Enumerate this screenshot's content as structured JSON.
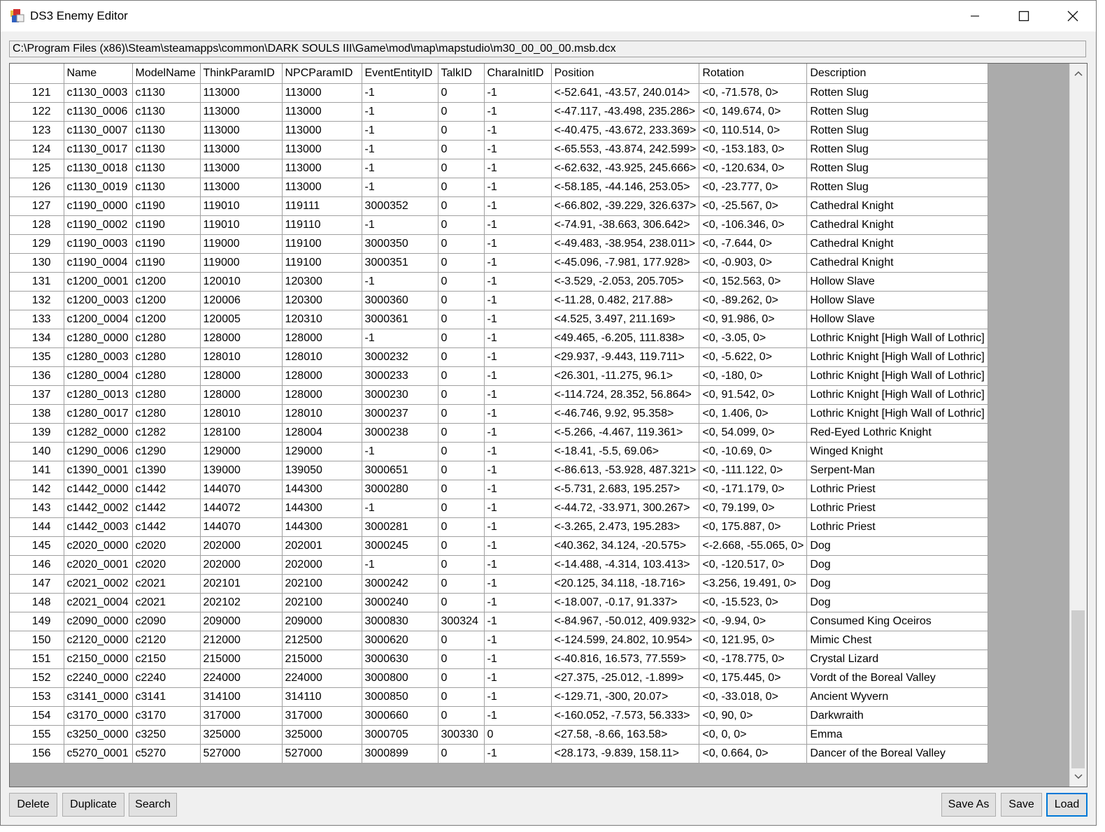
{
  "window": {
    "title": "DS3 Enemy Editor",
    "minimize_icon": "minimize-icon",
    "maximize_icon": "maximize-icon",
    "close_icon": "close-icon"
  },
  "path": "C:\\Program Files (x86)\\Steam\\steamapps\\common\\DARK SOULS III\\Game\\mod\\map\\mapstudio\\m30_00_00_00.msb.dcx",
  "grid": {
    "columns": [
      "Name",
      "ModelName",
      "ThinkParamID",
      "NPCParamID",
      "EventEntityID",
      "TalkID",
      "CharaInitID",
      "Position",
      "Rotation",
      "Description"
    ],
    "rows": [
      [
        "121",
        "c1130_0003",
        "c1130",
        "113000",
        "113000",
        "-1",
        "0",
        "-1",
        "<-52.641, -43.57, 240.014>",
        "<0, -71.578, 0>",
        "Rotten Slug"
      ],
      [
        "122",
        "c1130_0006",
        "c1130",
        "113000",
        "113000",
        "-1",
        "0",
        "-1",
        "<-47.117, -43.498, 235.286>",
        "<0, 149.674, 0>",
        "Rotten Slug"
      ],
      [
        "123",
        "c1130_0007",
        "c1130",
        "113000",
        "113000",
        "-1",
        "0",
        "-1",
        "<-40.475, -43.672, 233.369>",
        "<0, 110.514, 0>",
        "Rotten Slug"
      ],
      [
        "124",
        "c1130_0017",
        "c1130",
        "113000",
        "113000",
        "-1",
        "0",
        "-1",
        "<-65.553, -43.874, 242.599>",
        "<0, -153.183, 0>",
        "Rotten Slug"
      ],
      [
        "125",
        "c1130_0018",
        "c1130",
        "113000",
        "113000",
        "-1",
        "0",
        "-1",
        "<-62.632, -43.925, 245.666>",
        "<0, -120.634, 0>",
        "Rotten Slug"
      ],
      [
        "126",
        "c1130_0019",
        "c1130",
        "113000",
        "113000",
        "-1",
        "0",
        "-1",
        "<-58.185, -44.146, 253.05>",
        "<0, -23.777, 0>",
        "Rotten Slug"
      ],
      [
        "127",
        "c1190_0000",
        "c1190",
        "119010",
        "119111",
        "3000352",
        "0",
        "-1",
        "<-66.802, -39.229, 326.637>",
        "<0, -25.567, 0>",
        "Cathedral Knight"
      ],
      [
        "128",
        "c1190_0002",
        "c1190",
        "119010",
        "119110",
        "-1",
        "0",
        "-1",
        "<-74.91, -38.663, 306.642>",
        "<0, -106.346, 0>",
        "Cathedral Knight"
      ],
      [
        "129",
        "c1190_0003",
        "c1190",
        "119000",
        "119100",
        "3000350",
        "0",
        "-1",
        "<-49.483, -38.954, 238.011>",
        "<0, -7.644, 0>",
        "Cathedral Knight"
      ],
      [
        "130",
        "c1190_0004",
        "c1190",
        "119000",
        "119100",
        "3000351",
        "0",
        "-1",
        "<-45.096, -7.981, 177.928>",
        "<0, -0.903, 0>",
        "Cathedral Knight"
      ],
      [
        "131",
        "c1200_0001",
        "c1200",
        "120010",
        "120300",
        "-1",
        "0",
        "-1",
        "<-3.529, -2.053, 205.705>",
        "<0, 152.563, 0>",
        "Hollow Slave"
      ],
      [
        "132",
        "c1200_0003",
        "c1200",
        "120006",
        "120300",
        "3000360",
        "0",
        "-1",
        "<-11.28, 0.482, 217.88>",
        "<0, -89.262, 0>",
        "Hollow Slave"
      ],
      [
        "133",
        "c1200_0004",
        "c1200",
        "120005",
        "120310",
        "3000361",
        "0",
        "-1",
        "<4.525, 3.497, 211.169>",
        "<0, 91.986, 0>",
        "Hollow Slave"
      ],
      [
        "134",
        "c1280_0000",
        "c1280",
        "128000",
        "128000",
        "-1",
        "0",
        "-1",
        "<49.465, -6.205, 111.838>",
        "<0, -3.05, 0>",
        "Lothric Knight [High Wall of Lothric]"
      ],
      [
        "135",
        "c1280_0003",
        "c1280",
        "128010",
        "128010",
        "3000232",
        "0",
        "-1",
        "<29.937, -9.443, 119.711>",
        "<0, -5.622, 0>",
        "Lothric Knight [High Wall of Lothric]"
      ],
      [
        "136",
        "c1280_0004",
        "c1280",
        "128000",
        "128000",
        "3000233",
        "0",
        "-1",
        "<26.301, -11.275, 96.1>",
        "<0, -180, 0>",
        "Lothric Knight [High Wall of Lothric]"
      ],
      [
        "137",
        "c1280_0013",
        "c1280",
        "128000",
        "128000",
        "3000230",
        "0",
        "-1",
        "<-114.724, 28.352, 56.864>",
        "<0, 91.542, 0>",
        "Lothric Knight [High Wall of Lothric]"
      ],
      [
        "138",
        "c1280_0017",
        "c1280",
        "128010",
        "128010",
        "3000237",
        "0",
        "-1",
        "<-46.746, 9.92, 95.358>",
        "<0, 1.406, 0>",
        "Lothric Knight [High Wall of Lothric]"
      ],
      [
        "139",
        "c1282_0000",
        "c1282",
        "128100",
        "128004",
        "3000238",
        "0",
        "-1",
        "<-5.266, -4.467, 119.361>",
        "<0, 54.099, 0>",
        "Red-Eyed Lothric Knight"
      ],
      [
        "140",
        "c1290_0006",
        "c1290",
        "129000",
        "129000",
        "-1",
        "0",
        "-1",
        "<-18.41, -5.5, 69.06>",
        "<0, -10.69, 0>",
        "Winged Knight"
      ],
      [
        "141",
        "c1390_0001",
        "c1390",
        "139000",
        "139050",
        "3000651",
        "0",
        "-1",
        "<-86.613, -53.928, 487.321>",
        "<0, -111.122, 0>",
        "Serpent-Man"
      ],
      [
        "142",
        "c1442_0000",
        "c1442",
        "144070",
        "144300",
        "3000280",
        "0",
        "-1",
        "<-5.731, 2.683, 195.257>",
        "<0, -171.179, 0>",
        "Lothric Priest"
      ],
      [
        "143",
        "c1442_0002",
        "c1442",
        "144072",
        "144300",
        "-1",
        "0",
        "-1",
        "<-44.72, -33.971, 300.267>",
        "<0, 79.199, 0>",
        "Lothric Priest"
      ],
      [
        "144",
        "c1442_0003",
        "c1442",
        "144070",
        "144300",
        "3000281",
        "0",
        "-1",
        "<-3.265, 2.473, 195.283>",
        "<0, 175.887, 0>",
        "Lothric Priest"
      ],
      [
        "145",
        "c2020_0000",
        "c2020",
        "202000",
        "202001",
        "3000245",
        "0",
        "-1",
        "<40.362, 34.124, -20.575>",
        "<-2.668, -55.065, 0>",
        "Dog"
      ],
      [
        "146",
        "c2020_0001",
        "c2020",
        "202000",
        "202000",
        "-1",
        "0",
        "-1",
        "<-14.488, -4.314, 103.413>",
        "<0, -120.517, 0>",
        "Dog"
      ],
      [
        "147",
        "c2021_0002",
        "c2021",
        "202101",
        "202100",
        "3000242",
        "0",
        "-1",
        "<20.125, 34.118, -18.716>",
        "<3.256, 19.491, 0>",
        "Dog"
      ],
      [
        "148",
        "c2021_0004",
        "c2021",
        "202102",
        "202100",
        "3000240",
        "0",
        "-1",
        "<-18.007, -0.17, 91.337>",
        "<0, -15.523, 0>",
        "Dog"
      ],
      [
        "149",
        "c2090_0000",
        "c2090",
        "209000",
        "209000",
        "3000830",
        "300324",
        "-1",
        "<-84.967, -50.012, 409.932>",
        "<0, -9.94, 0>",
        "Consumed King Oceiros"
      ],
      [
        "150",
        "c2120_0000",
        "c2120",
        "212000",
        "212500",
        "3000620",
        "0",
        "-1",
        "<-124.599, 24.802, 10.954>",
        "<0, 121.95, 0>",
        "Mimic Chest"
      ],
      [
        "151",
        "c2150_0000",
        "c2150",
        "215000",
        "215000",
        "3000630",
        "0",
        "-1",
        "<-40.816, 16.573, 77.559>",
        "<0, -178.775, 0>",
        "Crystal Lizard"
      ],
      [
        "152",
        "c2240_0000",
        "c2240",
        "224000",
        "224000",
        "3000800",
        "0",
        "-1",
        "<27.375, -25.012, -1.899>",
        "<0, 175.445, 0>",
        "Vordt of the Boreal Valley"
      ],
      [
        "153",
        "c3141_0000",
        "c3141",
        "314100",
        "314110",
        "3000850",
        "0",
        "-1",
        "<-129.71, -300, 20.07>",
        "<0, -33.018, 0>",
        "Ancient Wyvern"
      ],
      [
        "154",
        "c3170_0000",
        "c3170",
        "317000",
        "317000",
        "3000660",
        "0",
        "-1",
        "<-160.052, -7.573, 56.333>",
        "<0, 90, 0>",
        "Darkwraith"
      ],
      [
        "155",
        "c3250_0000",
        "c3250",
        "325000",
        "325000",
        "3000705",
        "300330",
        "0",
        "<27.58, -8.66, 163.58>",
        "<0, 0, 0>",
        "Emma"
      ],
      [
        "156",
        "c5270_0001",
        "c5270",
        "527000",
        "527000",
        "3000899",
        "0",
        "-1",
        "<28.173, -9.839, 158.11>",
        "<0, 0.664, 0>",
        "Dancer of the Boreal Valley"
      ]
    ]
  },
  "buttons": {
    "delete": "Delete",
    "duplicate": "Duplicate",
    "search": "Search",
    "save_as": "Save As",
    "save": "Save",
    "load": "Load"
  },
  "colors": {
    "accent": "#0078d7",
    "window_bg": "#f0f0f0",
    "grid_empty": "#ababab"
  }
}
